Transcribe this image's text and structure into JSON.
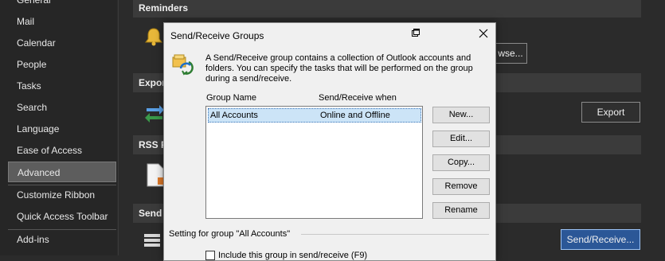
{
  "nav": {
    "items": [
      "General",
      "Mail",
      "Calendar",
      "People",
      "Tasks",
      "Search",
      "Language",
      "Ease of Access",
      "Advanced",
      "Customize Ribbon",
      "Quick Access Toolbar",
      "Add-ins"
    ],
    "active": "Advanced"
  },
  "sections": {
    "reminders": "Reminders",
    "export": "Expor",
    "rss": "RSS F",
    "send": "Send"
  },
  "buttons": {
    "browse": "wse...",
    "export": "Export",
    "send_receive": "Send/Receive..."
  },
  "dialog": {
    "title": "Send/Receive Groups",
    "description": "A Send/Receive group contains a collection of Outlook accounts and folders. You can specify the tasks that will be performed on the group during a send/receive.",
    "col_group_name": "Group Name",
    "col_when": "Send/Receive when",
    "rows": [
      {
        "name": "All Accounts",
        "when": "Online and Offline"
      }
    ],
    "buttons": {
      "new": "New...",
      "edit": "Edit...",
      "copy": "Copy...",
      "remove": "Remove",
      "rename": "Rename"
    },
    "group_setting_label": "Setting for group \"All Accounts\"",
    "include_label": "Include this group in send/receive (F9)"
  }
}
